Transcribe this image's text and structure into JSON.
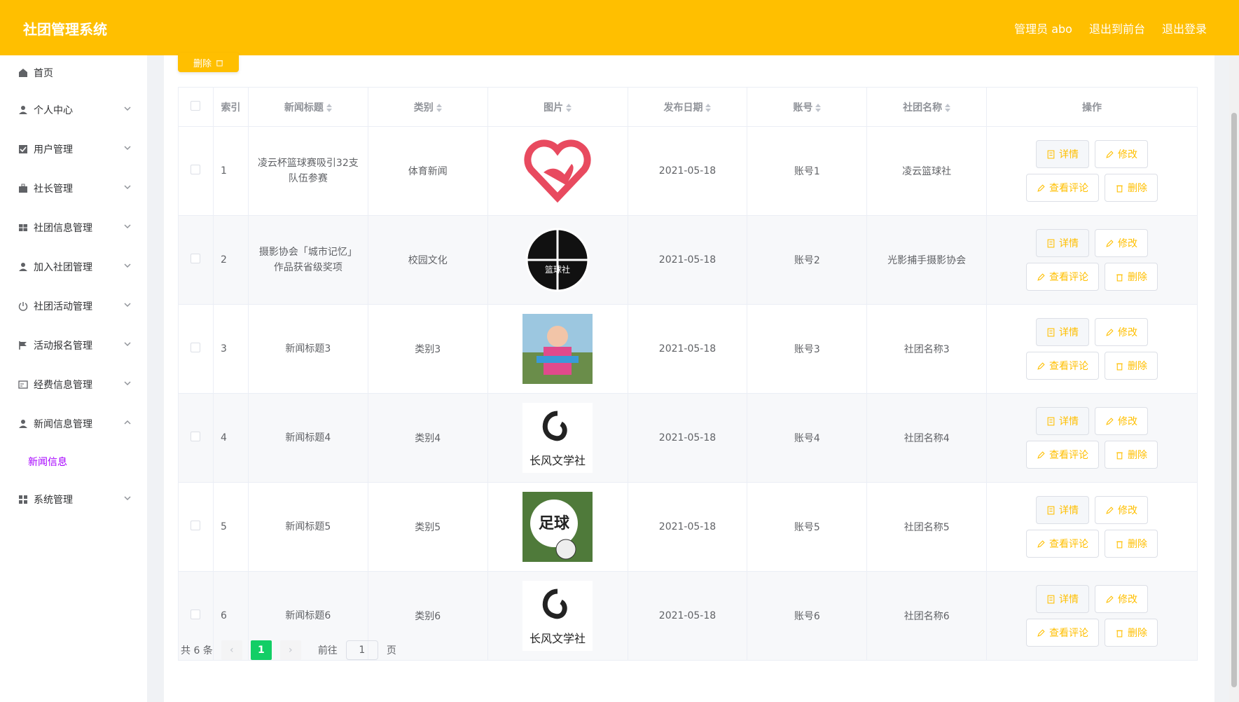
{
  "header": {
    "title": "社团管理系统",
    "admin_label": "管理员 abo",
    "to_front": "退出到前台",
    "logout": "退出登录"
  },
  "sidebar": {
    "items": [
      {
        "label": "首页",
        "icon": "home-icon"
      },
      {
        "label": "个人中心",
        "icon": "user-icon"
      },
      {
        "label": "用户管理",
        "icon": "clipboard-check-icon"
      },
      {
        "label": "社长管理",
        "icon": "briefcase-icon"
      },
      {
        "label": "社团信息管理",
        "icon": "grid-icon"
      },
      {
        "label": "加入社团管理",
        "icon": "user-icon"
      },
      {
        "label": "社团活动管理",
        "icon": "power-icon"
      },
      {
        "label": "活动报名管理",
        "icon": "flag-icon"
      },
      {
        "label": "经费信息管理",
        "icon": "card-icon"
      },
      {
        "label": "新闻信息管理",
        "icon": "user-icon"
      },
      {
        "label": "系统管理",
        "icon": "apps-icon"
      }
    ],
    "active_sub": "新闻信息"
  },
  "toolbar": {
    "delete_label": "删除"
  },
  "table": {
    "headers": [
      "索引",
      "新闻标题",
      "类别",
      "图片",
      "发布日期",
      "账号",
      "社团名称",
      "操作"
    ],
    "rows": [
      {
        "index": "1",
        "title": "凌云杯篮球赛吸引32支队伍参赛",
        "category": "体育新闻",
        "date": "2021-05-18",
        "account": "账号1",
        "club": "凌云篮球社",
        "img": "heart"
      },
      {
        "index": "2",
        "title": "摄影协会「城市记忆」作品获省级奖项",
        "category": "校园文化",
        "date": "2021-05-18",
        "account": "账号2",
        "club": "光影捕手摄影协会",
        "img": "ball",
        "img_text": "篮球社"
      },
      {
        "index": "3",
        "title": "新闻标题3",
        "category": "类别3",
        "date": "2021-05-18",
        "account": "账号3",
        "club": "社团名称3",
        "img": "photo"
      },
      {
        "index": "4",
        "title": "新闻标题4",
        "category": "类别4",
        "date": "2021-05-18",
        "account": "账号4",
        "club": "社团名称4",
        "img": "calli"
      },
      {
        "index": "5",
        "title": "新闻标题5",
        "category": "类别5",
        "date": "2021-05-18",
        "account": "账号5",
        "club": "社团名称5",
        "img": "football"
      },
      {
        "index": "6",
        "title": "新闻标题6",
        "category": "类别6",
        "date": "2021-05-18",
        "account": "账号6",
        "club": "社团名称6",
        "img": "calli"
      }
    ],
    "actions": {
      "detail": "详情",
      "edit": "修改",
      "comments": "查看评论",
      "delete": "删除"
    }
  },
  "pager": {
    "total": "共 6 条",
    "current": "1",
    "goto_prefix": "前往",
    "goto_value": "1",
    "goto_suffix": "页"
  },
  "colors": {
    "accent": "#ffbf00",
    "active_page": "#13ce66",
    "sub_active": "#a600ff"
  }
}
